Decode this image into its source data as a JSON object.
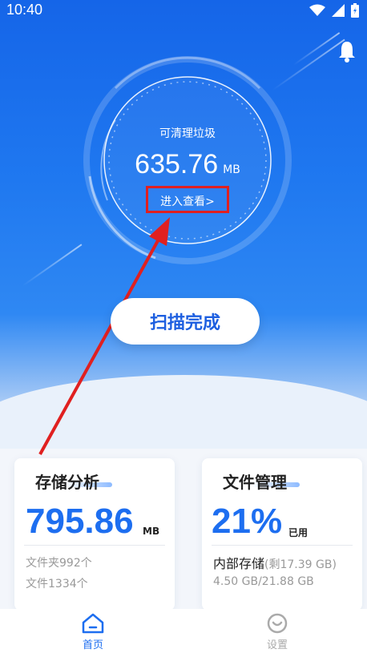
{
  "status_bar": {
    "time": "10:40"
  },
  "gauge": {
    "label": "可清理垃圾",
    "value": "635.76",
    "unit": "MB",
    "link": "进入查看>"
  },
  "scan_button": {
    "label": "扫描完成"
  },
  "storage_card": {
    "title": "存储分析",
    "value": "795.86",
    "unit": "MB",
    "folders": "文件夹992个",
    "files": "文件1334个"
  },
  "file_card": {
    "title": "文件管理",
    "percent": "21%",
    "percent_label": "已用",
    "storage_label": "内部存储",
    "remaining": "(剩17.39 GB)",
    "used": "4.50 GB/21.88 GB"
  },
  "tabs": [
    {
      "label": "首页",
      "icon": "home-icon",
      "active": true
    },
    {
      "label": "设置",
      "icon": "settings-icon",
      "active": false
    }
  ],
  "colors": {
    "primary": "#1d6ef0",
    "annotation": "#e02020",
    "inactive": "#aaaaaa"
  }
}
